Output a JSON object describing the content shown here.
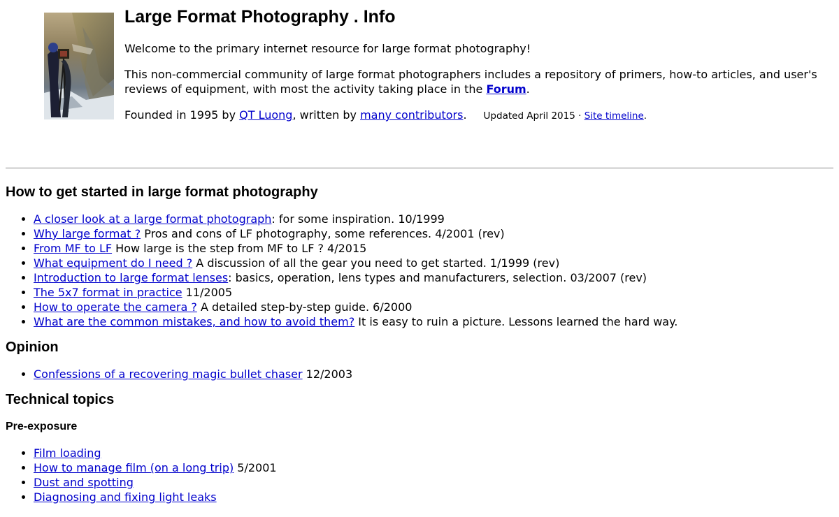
{
  "header": {
    "title": "Large Format Photography . Info",
    "welcome": "Welcome to the primary internet resource for large format photography!",
    "intro_text": "This non-commercial community of large format photographers includes a repository of primers, how-to articles, and user's reviews of equipment, with most the activity taking place in the ",
    "forum_link": "Forum",
    "intro_end": ".",
    "founded_prefix": "Founded in 1995 by ",
    "founder_link": "QT Luong",
    "founded_middle": ", written by ",
    "contributors_link": "many contributors",
    "founded_end": ".",
    "updated_text": "Updated April 2015 · ",
    "timeline_link": "Site timeline",
    "updated_end": "."
  },
  "getting_started": {
    "heading": "How to get started in large format photography",
    "items": [
      {
        "link": "A closer look at a large format photograph",
        "text": ": for some inspiration. 10/1999"
      },
      {
        "link": "Why large format ?",
        "text": " Pros and cons of LF photography, some references. 4/2001 (rev)"
      },
      {
        "link": "From MF to LF",
        "text": " How large is the step from MF to LF ? 4/2015"
      },
      {
        "link": "What equipment do I need ?",
        "text": " A discussion of all the gear you need to get started. 1/1999 (rev)"
      },
      {
        "link": "Introduction to large format lenses",
        "text": ": basics, operation, lens types and manufacturers, selection. 03/2007 (rev)"
      },
      {
        "link": "The 5x7 format in practice",
        "text": " 11/2005"
      },
      {
        "link": "How to operate the camera ?",
        "text": " A detailed step-by-step guide. 6/2000"
      },
      {
        "link": "What are the common mistakes, and how to avoid them?",
        "text": " It is easy to ruin a picture. Lessons learned the hard way."
      }
    ]
  },
  "opinion": {
    "heading": "Opinion",
    "items": [
      {
        "link": "Confessions of a recovering magic bullet chaser",
        "text": " 12/2003"
      }
    ]
  },
  "technical": {
    "heading": "Technical topics",
    "pre_exposure": {
      "heading": "Pre-exposure",
      "items": [
        {
          "link": "Film loading",
          "text": ""
        },
        {
          "link": "How to manage film (on a long trip)",
          "text": " 5/2001"
        },
        {
          "link": "Dust and spotting",
          "text": ""
        },
        {
          "link": "Diagnosing and fixing light leaks",
          "text": ""
        }
      ]
    }
  },
  "colors": {
    "link": "#0000cc",
    "divider": "#888888"
  }
}
